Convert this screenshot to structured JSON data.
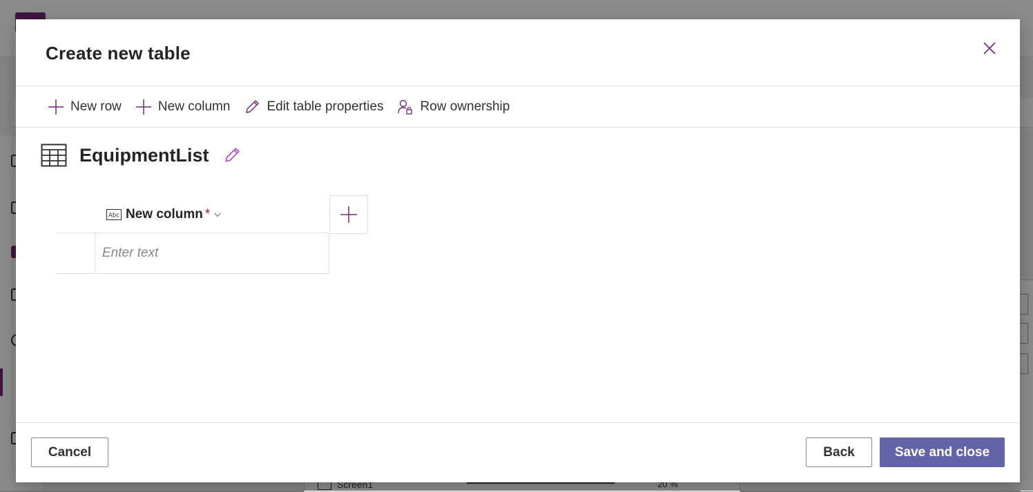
{
  "background": {
    "screen_label": "Screen1",
    "zoom_value": "20",
    "zoom_unit": "%"
  },
  "dialog": {
    "title": "Create new table",
    "close_icon": "close-icon"
  },
  "toolbar": {
    "new_row": "New row",
    "new_column": "New column",
    "edit_table_properties": "Edit table properties",
    "row_ownership": "Row ownership"
  },
  "table": {
    "name": "EquipmentList",
    "columns": [
      {
        "label": "New column",
        "required_marker": "*",
        "type_icon": "text-type-icon"
      }
    ],
    "rows": [
      {
        "cells": [
          {
            "value": "",
            "placeholder": "Enter text"
          }
        ]
      }
    ]
  },
  "footer": {
    "cancel": "Cancel",
    "back": "Back",
    "save_and_close": "Save and close"
  },
  "colors": {
    "accent": "#742774",
    "primary_button": "#6264a7"
  }
}
